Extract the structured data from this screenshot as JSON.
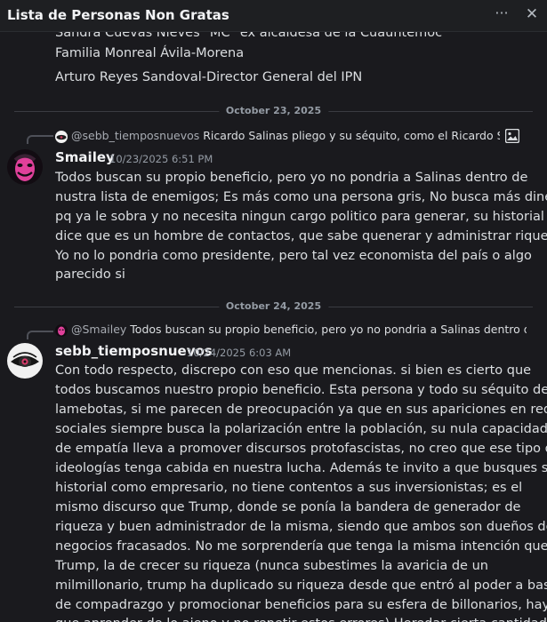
{
  "window": {
    "title": "Lista de Personas Non Gratas",
    "more_label": "···",
    "close_label": "✕"
  },
  "previous_message": {
    "lines": [
      "Sandra Cuevas Nieves \"MC\" ex alcaldesa de la Cuauhtemoc",
      "Familia Monreal Ávila-Morena",
      "Arturo Reyes Sandoval-Director General del IPN"
    ]
  },
  "dividers": {
    "first": "October 23, 2025",
    "second": "October 24, 2025"
  },
  "messages": [
    {
      "reply": {
        "mention": "@sebb_tiemposnuevos",
        "excerpt": "Ricardo Salinas pliego y su séquito, como el Ricardo Sali…",
        "icon": "image-icon"
      },
      "author": "Smailey",
      "timestamp": "10/23/2025 6:51 PM",
      "lines": [
        "Todos buscan su propio beneficio, pero yo no pondria a Salinas dentro de",
        "nustra lista de enemigos; Es más como una persona gris, No busca más dinero",
        "pq ya le sobra y no necesita ningun cargo politico para generar, su historial nos",
        "dice que es un hombre de contactos, que sabe quenerar y administrar riqueza.",
        "Yo no lo pondria como presidente, pero tal vez economista del país o algo",
        "parecido si"
      ],
      "avatar": "pink-mask-avatar",
      "accent": "#e0409a"
    },
    {
      "reply": {
        "mention": "@Smailey",
        "excerpt": "Todos buscan su propio beneficio, pero yo no pondria a Salinas dentro de …"
      },
      "author": "sebb_tiemposnuevos",
      "timestamp": "10/24/2025 6:03 AM",
      "lines": [
        "Con todo respecto, discrepo con eso que mencionas. si bien es cierto que",
        "todos buscamos nuestro propio beneficio. Esta persona y todo su séquito de",
        "lamebotas, si me parecen de preocupación ya que en sus apariciones en redes",
        "sociales siempre busca la polarización entre la población, su nula capacidad",
        "de empatía lleva a promover discursos protofascistas, no creo que ese tipo de",
        "ideologías tenga cabida en nuestra lucha. Además te invito a que busques su",
        "historial como empresario, no tiene contentos a sus inversionistas; es el",
        "mismo discurso que Trump, donde se ponía la bandera de generador de",
        "riqueza y buen administrador de la misma, siendo que ambos son dueños de",
        "negocios fracasados. No me sorprendería que tenga la misma intención que",
        "Trump, la de crecer su riqueza (nunca subestimes la avaricia de un",
        "milmillonario, trump ha duplicado su riqueza desde que entró al poder a base",
        "de compadrazgo y promocionar beneficios para su esfera de billonarios, hay",
        "que aprender de lo ajeno y no repetir estos errores) Heredar cierta cantidad"
      ],
      "avatar": "eye-avatar",
      "accent": "#d63b6a"
    }
  ]
}
